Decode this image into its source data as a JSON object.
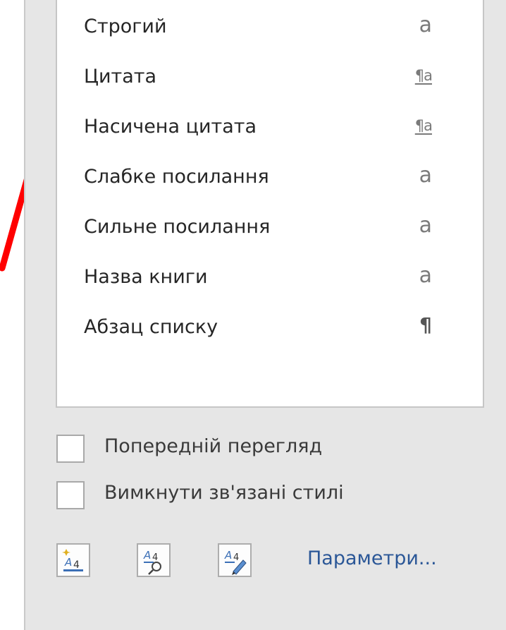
{
  "styles_list": {
    "items": [
      {
        "name": "Строгий",
        "type_glyph": "a",
        "kind": "char"
      },
      {
        "name": "Цитата",
        "type_glyph": "¶a",
        "kind": "para-char"
      },
      {
        "name": "Насичена цитата",
        "type_glyph": "¶a",
        "kind": "para-char"
      },
      {
        "name": "Слабке посилання",
        "type_glyph": "a",
        "kind": "char"
      },
      {
        "name": "Сильне посилання",
        "type_glyph": "a",
        "kind": "char"
      },
      {
        "name": "Назва книги",
        "type_glyph": "a",
        "kind": "char"
      },
      {
        "name": "Абзац списку",
        "type_glyph": "¶",
        "kind": "para"
      }
    ]
  },
  "options": {
    "preview_label": "Попередній перегляд",
    "disable_linked_label": "Вимкнути зв'язані стилі",
    "preview_checked": false,
    "disable_linked_checked": false
  },
  "footer": {
    "new_style_icon": "new-style-icon",
    "style_inspector_icon": "style-inspector-icon",
    "manage_styles_icon": "manage-styles-icon",
    "options_link": "Параметри..."
  },
  "colors": {
    "annotation_line": "#ff0000",
    "link": "#2b5797",
    "pane_bg": "#e6e6e6"
  }
}
